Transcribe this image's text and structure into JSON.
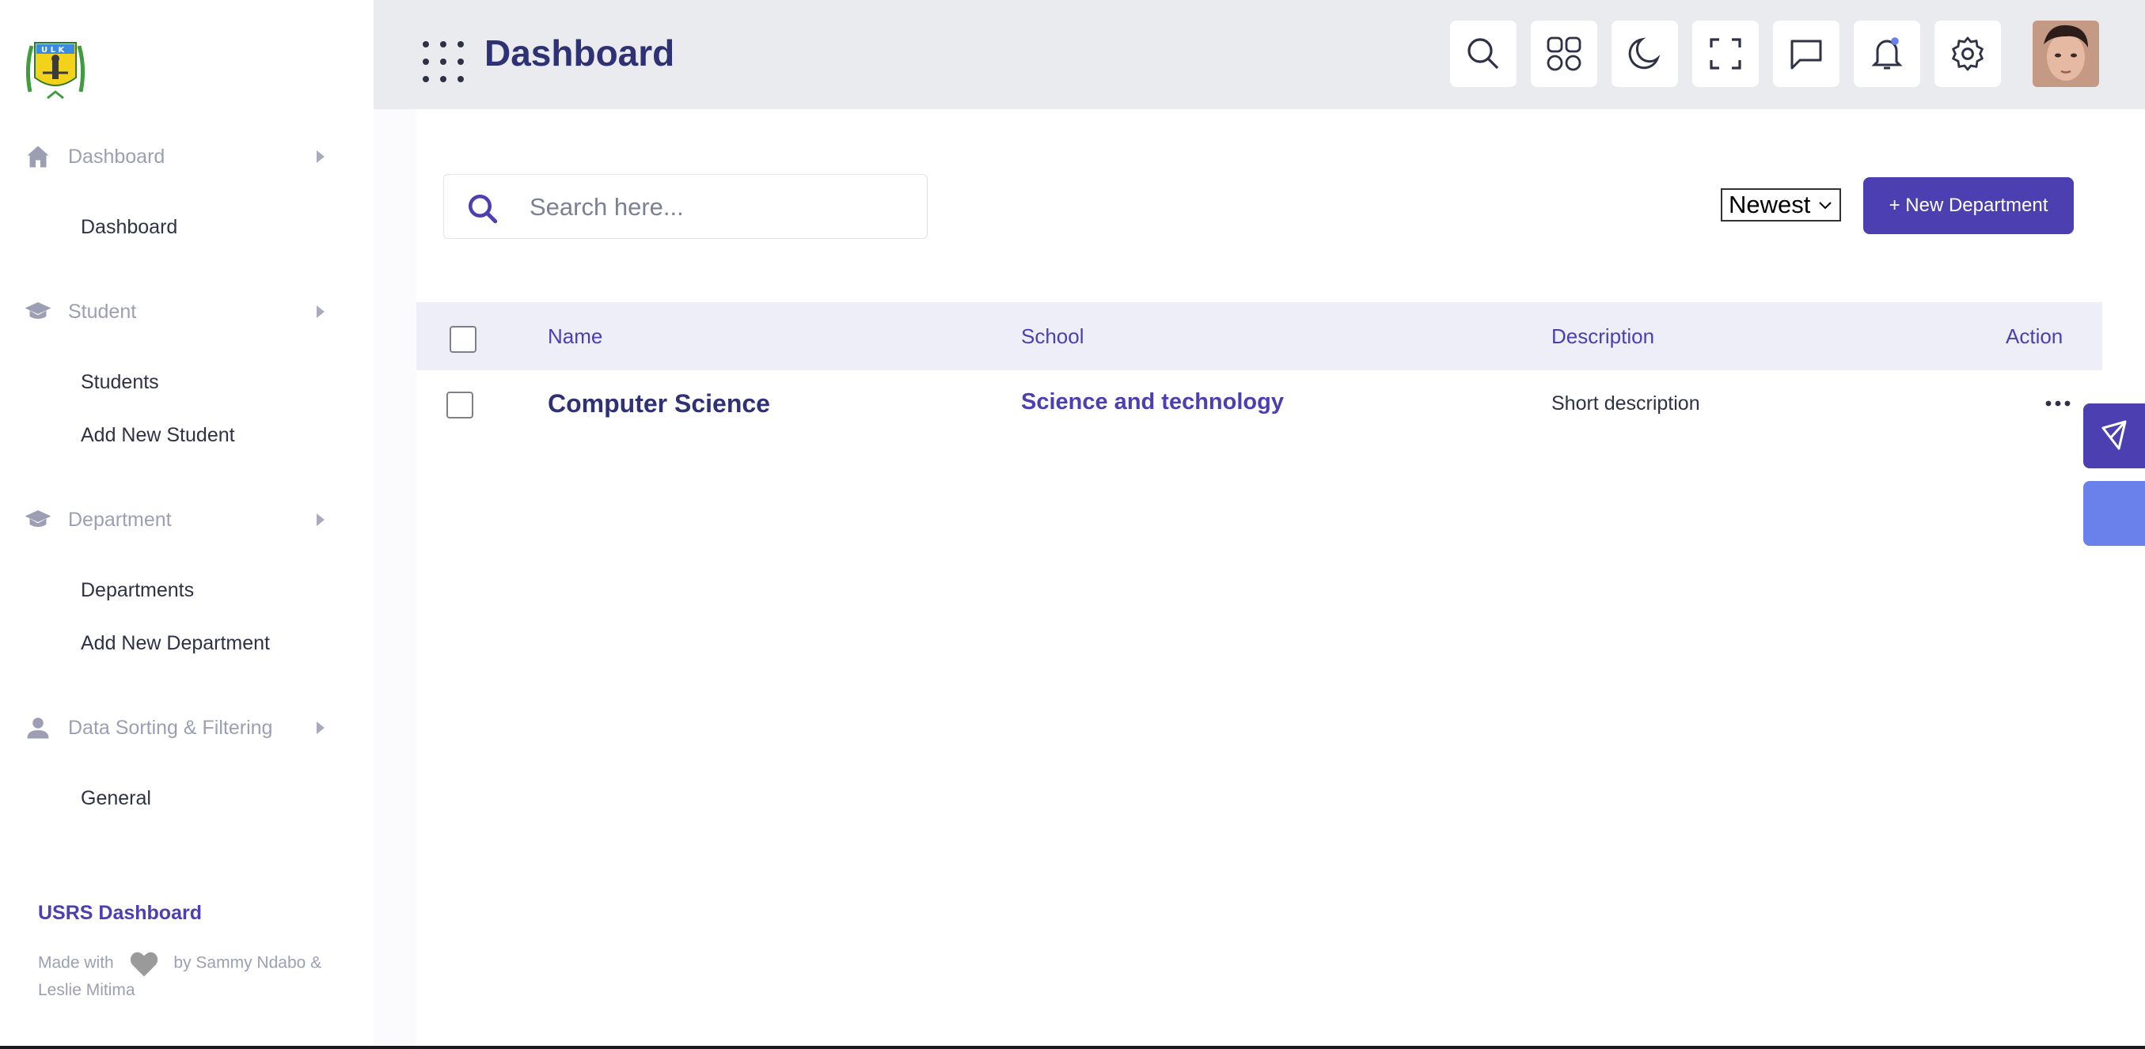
{
  "sidebar": {
    "sections": [
      {
        "label": "Dashboard",
        "icon": "home-icon",
        "items": [
          "Dashboard"
        ]
      },
      {
        "label": "Student",
        "icon": "graduation-cap-icon",
        "items": [
          "Students",
          "Add New Student"
        ]
      },
      {
        "label": "Department",
        "icon": "graduation-cap-icon",
        "items": [
          "Departments",
          "Add New Department"
        ]
      },
      {
        "label": "Data Sorting & Filtering",
        "icon": "person-icon",
        "items": [
          "General"
        ]
      }
    ],
    "footer_title": "USRS Dashboard",
    "footer_made_prefix": "Made with",
    "footer_made_suffix": "by Sammy Ndabo & Leslie Mitima"
  },
  "header": {
    "title": "Dashboard",
    "buttons": [
      "search-icon",
      "apps-icon",
      "moon-icon",
      "fullscreen-icon",
      "chat-icon",
      "bell-icon",
      "gear-icon"
    ]
  },
  "toolbar": {
    "search_placeholder": "Search here...",
    "sort_value": "Newest",
    "new_button": "+ New Department"
  },
  "table": {
    "columns": [
      "Name",
      "School",
      "Description",
      "Action"
    ],
    "rows": [
      {
        "name": "Computer Science",
        "school": "Science and technology",
        "description": "Short description"
      }
    ]
  },
  "colors": {
    "accent": "#4b3fb2",
    "header_bg": "#e9ebee",
    "table_head_bg": "#eeeef8"
  }
}
